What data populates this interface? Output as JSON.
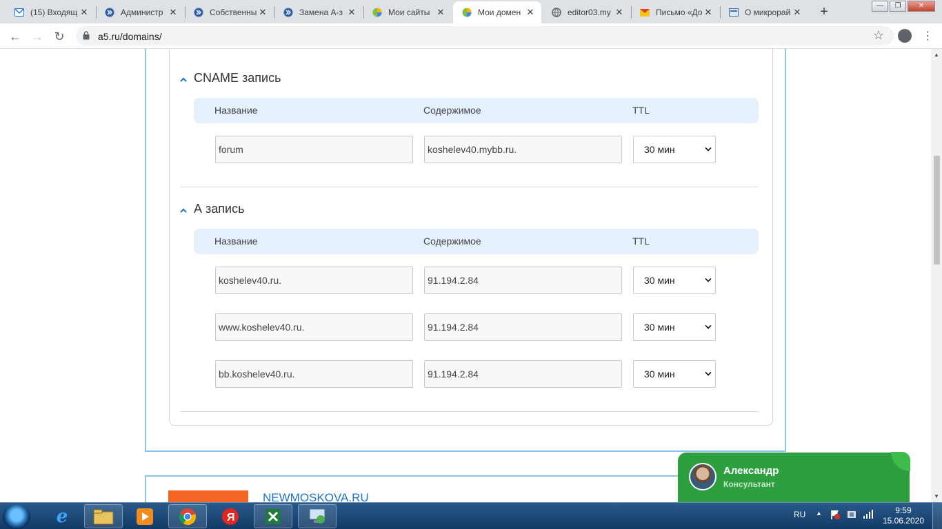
{
  "browser": {
    "tabs": [
      {
        "title": "(15) Входящ",
        "icon": "mail-icon",
        "active": false
      },
      {
        "title": "Администр",
        "icon": "chevron-app-icon",
        "active": false
      },
      {
        "title": "Собственны",
        "icon": "chevron-app-icon",
        "active": false
      },
      {
        "title": "Замена А-з",
        "icon": "chevron-app-icon",
        "active": false
      },
      {
        "title": "Мои сайты",
        "icon": "globe-color-icon",
        "active": false
      },
      {
        "title": "Мои домен",
        "icon": "globe-color-icon",
        "active": true
      },
      {
        "title": "editor03.my",
        "icon": "globe-icon",
        "active": false
      },
      {
        "title": "Письмо «До",
        "icon": "envelope-icon",
        "active": false
      },
      {
        "title": "О микрорай",
        "icon": "site-icon",
        "active": false
      }
    ],
    "new_tab_label": "+",
    "url": "a5.ru/domains/"
  },
  "dns": {
    "cname_section": {
      "title": "CNAME запись",
      "headers": {
        "name": "Название",
        "content": "Содержимое",
        "ttl": "TTL"
      },
      "rows": [
        {
          "name": "forum",
          "content": "koshelev40.mybb.ru.",
          "ttl": "30 мин"
        }
      ]
    },
    "a_section": {
      "title": "А запись",
      "headers": {
        "name": "Название",
        "content": "Содержимое",
        "ttl": "TTL"
      },
      "rows": [
        {
          "name": "koshelev40.ru.",
          "content": "91.194.2.84",
          "ttl": "30 мин"
        },
        {
          "name": "www.koshelev40.ru.",
          "content": "91.194.2.84",
          "ttl": "30 мин"
        },
        {
          "name": "bb.koshelev40.ru.",
          "content": "91.194.2.84",
          "ttl": "30 мин"
        }
      ]
    }
  },
  "next_domain": {
    "name": "NEWMOSKOVA.RU"
  },
  "chat": {
    "name": "Александр",
    "role": "Консультант"
  },
  "taskbar": {
    "lang": "RU",
    "time": "9:59",
    "date": "15.06.2020"
  },
  "colors": {
    "card_border": "#8ec2ea",
    "table_header_bg": "#e4f0fb",
    "chat_green": "#2e9f3f",
    "accent_orange": "#f26522",
    "link_blue": "#1a73c7"
  }
}
